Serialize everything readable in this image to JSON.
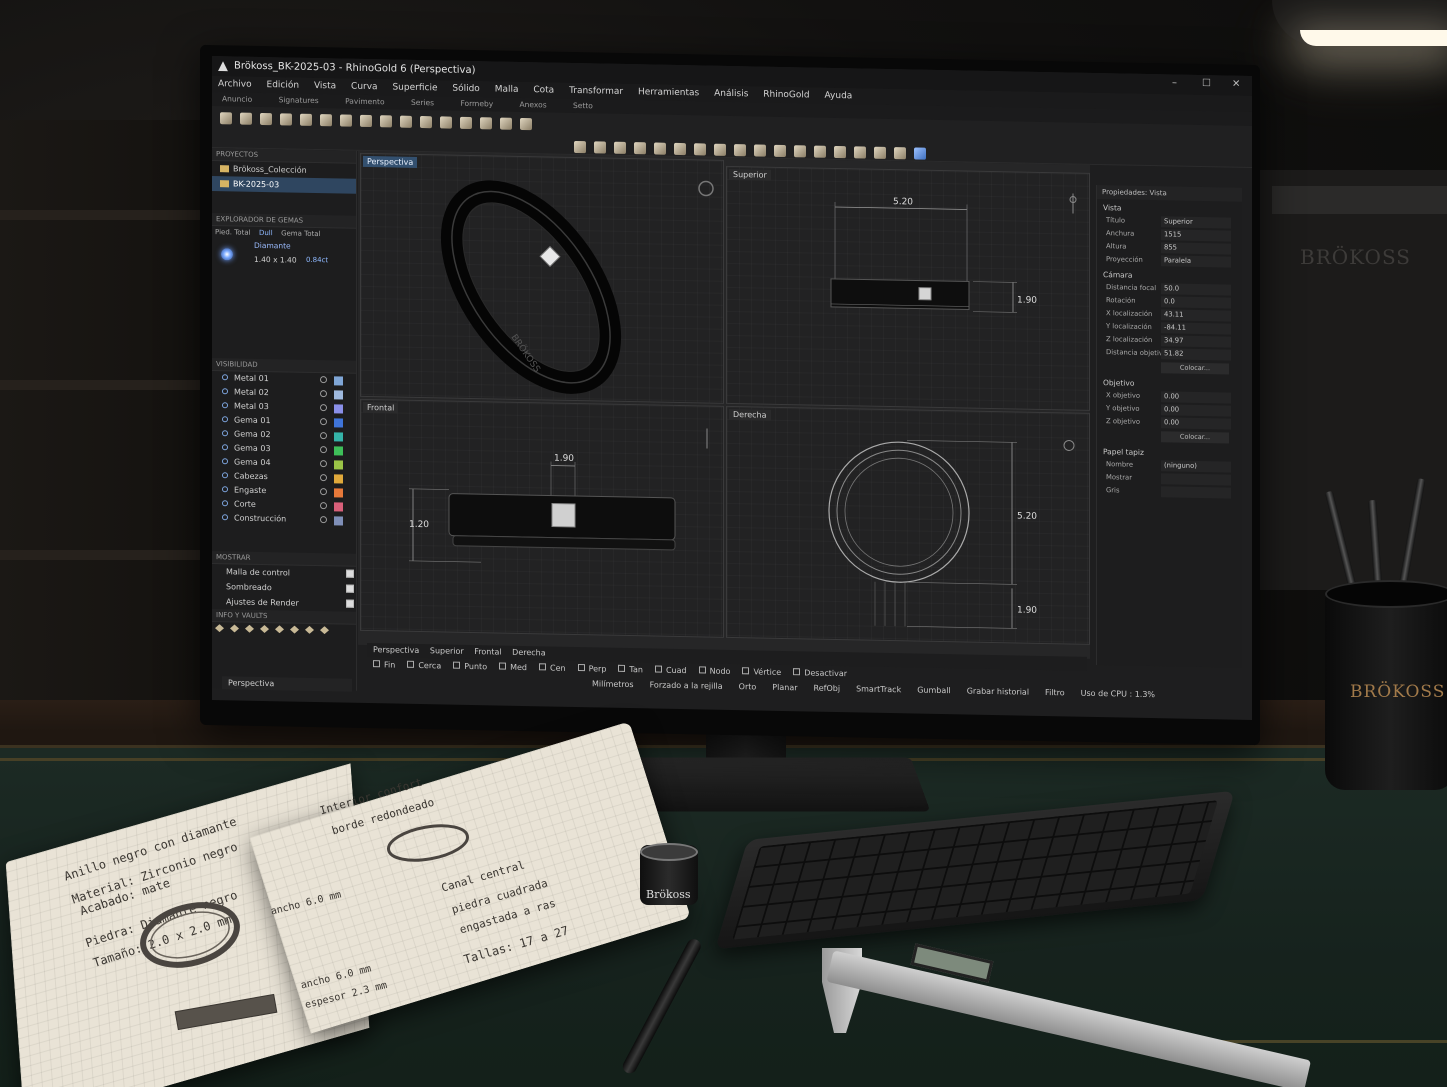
{
  "window": {
    "title": "Brökoss_BK-2025-03 - RhinoGold 6 (Perspectiva)",
    "minimize": "–",
    "maximize": "☐",
    "close": "✕"
  },
  "menu": [
    "Archivo",
    "Edición",
    "Vista",
    "Curva",
    "Superficie",
    "Sólido",
    "Malla",
    "Cota",
    "Transformar",
    "Herramientas",
    "Análisis",
    "RhinoGold",
    "Ayuda"
  ],
  "ribbon_tabs": [
    "Anuncio",
    "Signatures",
    "Pavimento",
    "Series",
    "Formeby",
    "Anexos",
    "Setto"
  ],
  "projects": {
    "title": "PROYECTOS",
    "items": [
      "Brökoss_Colección",
      "BK-2025-03"
    ]
  },
  "gem_explorer": {
    "title": "EXPLORADOR DE GEMAS",
    "tabs": [
      "Pied. Total",
      "Dull",
      "Gema Total"
    ],
    "gem": {
      "name": "Diamante",
      "size": "1.40 x 1.40",
      "total": "0.84ct"
    }
  },
  "visibility": {
    "title": "VISIBILIDAD",
    "layers": [
      {
        "name": "Metal 01",
        "color": "#7fa6d6"
      },
      {
        "name": "Metal 02",
        "color": "#9fb9de"
      },
      {
        "name": "Metal 03",
        "color": "#8a8fe8"
      },
      {
        "name": "Gema 01",
        "color": "#3f74d9"
      },
      {
        "name": "Gema 02",
        "color": "#35b3a8"
      },
      {
        "name": "Gema 03",
        "color": "#3ebf59"
      },
      {
        "name": "Gema 04",
        "color": "#9bc447"
      },
      {
        "name": "Cabezas",
        "color": "#e0a93b"
      },
      {
        "name": "Engaste",
        "color": "#e7793a"
      },
      {
        "name": "Corte",
        "color": "#d9607a"
      },
      {
        "name": "Construcción",
        "color": "#7f8fb8"
      }
    ]
  },
  "show": {
    "title": "MOSTRAR",
    "items": [
      "Malla de control",
      "Sombreado",
      "Ajustes de Render"
    ]
  },
  "info": {
    "title": "INFO Y VAULTS"
  },
  "command": "Perspectiva",
  "viewports": {
    "perspective": {
      "label": "Perspectiva",
      "engraving": "BRÖKOSS"
    },
    "top": {
      "label": "Superior",
      "dim_width": "5.20",
      "dim_height": "1.90"
    },
    "front": {
      "label": "Frontal",
      "dim_stone": "1.90",
      "dim_height": "1.20"
    },
    "right": {
      "label": "Derecha",
      "dim_diameter": "5.20",
      "dim_thickness": "1.90"
    }
  },
  "viewport_tabs": [
    "Perspectiva",
    "Superior",
    "Frontal",
    "Derecha"
  ],
  "snaps": [
    "Fin",
    "Cerca",
    "Punto",
    "Med",
    "Cen",
    "Perp",
    "Tan",
    "Cuad",
    "Nodo",
    "Vértice",
    "Desactivar"
  ],
  "status": [
    "Milímetros",
    "Forzado a la rejilla",
    "Orto",
    "Planar",
    "RefObj",
    "SmartTrack",
    "Gumball",
    "Grabar historial",
    "Filtro",
    "Uso de CPU : 1.3%"
  ],
  "properties": {
    "title": "Propiedades: Vista",
    "vista": {
      "title": "Vista",
      "rows": [
        [
          "Título",
          "Superior"
        ],
        [
          "Anchura",
          "1515"
        ],
        [
          "Altura",
          "855"
        ],
        [
          "Proyección",
          "Paralela"
        ]
      ]
    },
    "camara": {
      "title": "Cámara",
      "rows": [
        [
          "Distancia focal",
          "50.0"
        ],
        [
          "Rotación",
          "0.0"
        ],
        [
          "X localización",
          "43.11"
        ],
        [
          "Y localización",
          "-84.11"
        ],
        [
          "Z localización",
          "34.97"
        ],
        [
          "Distancia objetivo",
          "51.82"
        ]
      ],
      "button": "Colocar..."
    },
    "objetivo": {
      "title": "Objetivo",
      "rows": [
        [
          "X objetivo",
          "0.00"
        ],
        [
          "Y objetivo",
          "0.00"
        ],
        [
          "Z objetivo",
          "0.00"
        ]
      ],
      "button": "Colocar..."
    },
    "papel": {
      "title": "Papel tapiz",
      "rows": [
        [
          "Nombre",
          "(ninguno)"
        ],
        [
          "Mostrar",
          ""
        ],
        [
          "Gris",
          ""
        ]
      ]
    }
  },
  "notebook": {
    "left": [
      "Anillo negro con diamante",
      "Material: Zirconio negro",
      "Acabado: mate",
      "Piedra: Diamante negro",
      "Tamaño: 2.0 x 2.0 mm"
    ],
    "left_dims": [
      "ancho 6.0 mm",
      "ancho 6.0 mm",
      "espesor 2.3 mm"
    ],
    "right": [
      "Interior confort",
      "borde redondeado",
      "Canal central",
      "piedra cuadrada",
      "engastada a ras",
      "Tallas: 17 a 27"
    ]
  },
  "brand": {
    "wall": "BRÖKOSS",
    "cup": "BRÖKOSS",
    "loupe": "Brökoss"
  }
}
